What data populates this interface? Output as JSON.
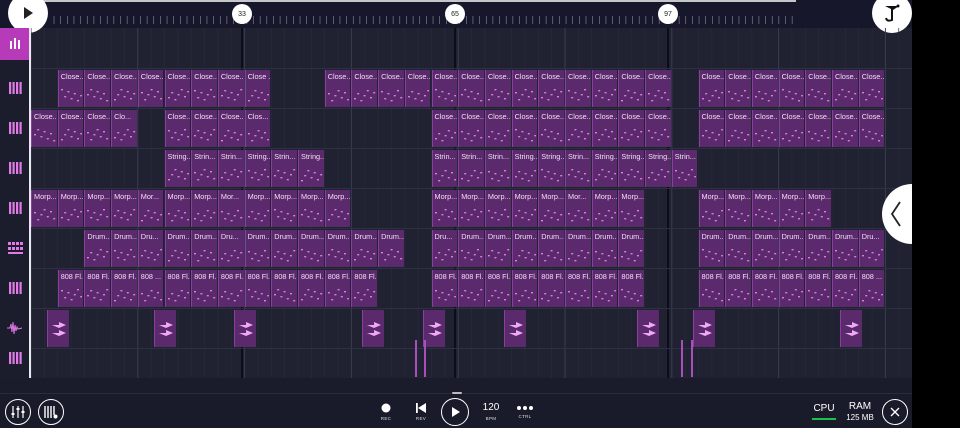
{
  "timeline": {
    "markers": [
      {
        "label": "33"
      },
      {
        "label": "65"
      },
      {
        "label": "97"
      }
    ]
  },
  "tracks": [
    {
      "name": "drum-pads",
      "icon": "drum-pad-icon",
      "active": true
    },
    {
      "name": "piano-roll-1",
      "icon": "piano-keys-icon"
    },
    {
      "name": "piano-roll-2",
      "icon": "piano-keys-icon"
    },
    {
      "name": "piano-roll-3",
      "icon": "piano-keys-icon"
    },
    {
      "name": "piano-roll-4",
      "icon": "piano-keys-icon"
    },
    {
      "name": "drum-sequencer",
      "icon": "drum-grid-icon"
    },
    {
      "name": "piano-roll-5",
      "icon": "piano-keys-icon"
    },
    {
      "name": "audio-track",
      "icon": "waveform-icon"
    },
    {
      "name": "piano-roll-6",
      "icon": "piano-keys-icon"
    }
  ],
  "rows": [
    {
      "label": "Close...",
      "short": [
        "Close...",
        "Close...",
        "Close...",
        "Close...",
        "Close...",
        "Close...",
        "Close...",
        "Close ...",
        "Close...",
        "Close...",
        "Close...",
        "Close...",
        "Close...",
        "Close...",
        "Close...",
        "Close...",
        "Close...",
        "Close...",
        "Close...",
        "Close...",
        "Close...",
        "Close...",
        "Close...",
        "Close...",
        "Close...",
        "Close...",
        "Close..."
      ]
    },
    {
      "label": "Close...",
      "short": [
        "Close...",
        "Close...",
        "Close...",
        "Clo...",
        "Close...",
        "Close...",
        "Close...",
        "Clos...",
        "Close...",
        "Close...",
        "Close...",
        "Close...",
        "Close...",
        "Close...",
        "Close...",
        "Close...",
        "Close...",
        "Close...",
        "Close...",
        "Close...",
        "Close...",
        "Close...",
        "Close...",
        "Close...",
        "Close..."
      ]
    },
    {
      "label": "String...",
      "short": [
        "String...",
        "Strin...",
        "Strin...",
        "String...",
        "Strin...",
        "String...",
        "Strin...",
        "Strin...",
        "Strin...",
        "String...",
        "String...",
        "Strin...",
        "String...",
        "String...",
        "String...",
        "Strin..."
      ]
    },
    {
      "label": "Morp...",
      "short": [
        "Morp...",
        "Morp...",
        "Morp...",
        "Morp...",
        "Mor...",
        "Morp...",
        "Morp...",
        "Mor...",
        "Morp...",
        "Morp...",
        "Morp...",
        "Morp...",
        "Morp...",
        "Morp...",
        "Morp...",
        "Morp...",
        "Morp...",
        "Mor...",
        "Morp...",
        "Morp...",
        "Morp...",
        "Morp...",
        "Morp..."
      ]
    },
    {
      "label": "Drum...",
      "short": [
        "Drum...",
        "Drum...",
        "Dru...",
        "Drum...",
        "Drum...",
        "Dru...",
        "Drum...",
        "Drum...",
        "Drum...",
        "Drum...",
        "Drum...",
        "Drum...",
        "Dru...",
        "Drum...",
        "Drum...",
        "Drum...",
        "Drum...",
        "Drum...",
        "Drum...",
        "Drum...",
        "Drum...",
        "Drum...",
        "Drum...",
        "Drum..."
      ]
    },
    {
      "label": "808 Fl...",
      "short": [
        "808 Fl...",
        "808 Fl...",
        "808 Fl...",
        "808 ...",
        "808 Fl...",
        "808 Fl...",
        "808 Fl...",
        "808 Fl...",
        "808 Fl...",
        "808 Fl...",
        "808 Fl...",
        "808 Fl...",
        "808 Fl...",
        "808 Fl...",
        "808 Fl...",
        "808 Fl...",
        "808 Fl...",
        "808 Fl...",
        "808 Fl...",
        "808 Fl...",
        "808 Fl...",
        "808 Fl...",
        "808 Fl..."
      ]
    }
  ],
  "toolbar": {
    "rec_label": "REC",
    "rev_label": "REV",
    "bpm_value": "120",
    "bpm_label": "BPM",
    "ctrl_label": "CTRL",
    "cpu_label": "CPU",
    "ram_label": "RAM",
    "ram_value": "125 MB"
  },
  "colors": {
    "background": "#202232",
    "clip": "#5b2a6c",
    "accent": "#b73ab8",
    "note": "#e07ae8",
    "cpu_ok": "#19c34a"
  }
}
